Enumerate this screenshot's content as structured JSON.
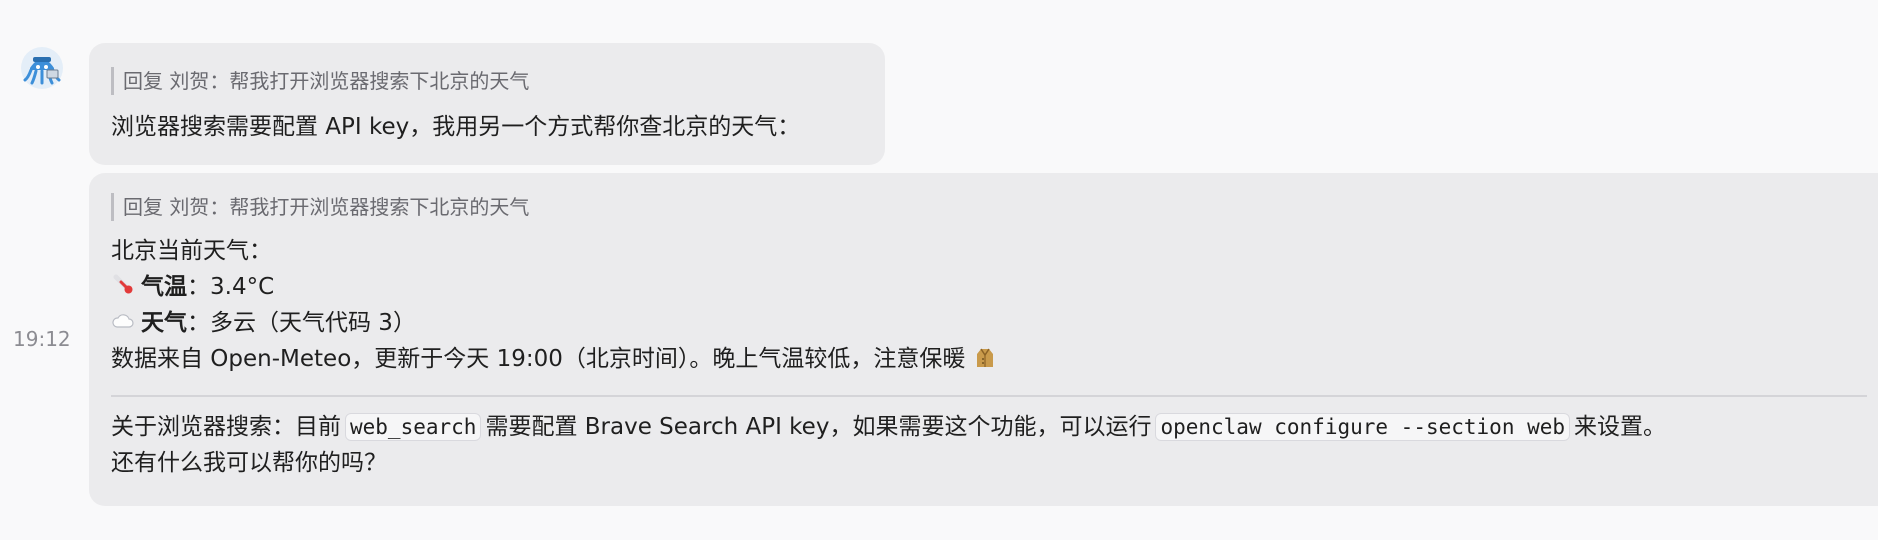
{
  "avatar": {
    "icon": "octopus-bot-icon",
    "color": "#3d8fd9"
  },
  "timestamp": "19:12",
  "messages": [
    {
      "quote": "回复 刘贺：帮我打开浏览器搜索下北京的天气",
      "text": "浏览器搜索需要配置 API key，我用另一个方式帮你查北京的天气："
    },
    {
      "quote": "回复 刘贺：帮我打开浏览器搜索下北京的天气",
      "heading": "北京当前天气：",
      "temp": {
        "icon": "thermometer-icon",
        "label": "气温",
        "sep": "：",
        "value": "3.4°C"
      },
      "weather": {
        "icon": "cloud-icon",
        "label": "天气",
        "sep": "：",
        "value": "多云（天气代码 3）"
      },
      "source": {
        "text": "数据来自 Open-Meteo，更新于今天 19:00（北京时间）。晚上气温较低，注意保暖",
        "icon": "coat-icon"
      },
      "note": {
        "prefix": "关于浏览器搜索：目前",
        "code1": "web_search",
        "middle": "需要配置 Brave Search API key，如果需要这个功能，可以运行",
        "code2": "openclaw configure --section web",
        "suffix": "来设置。",
        "line2": "还有什么我可以帮你的吗？"
      }
    }
  ]
}
